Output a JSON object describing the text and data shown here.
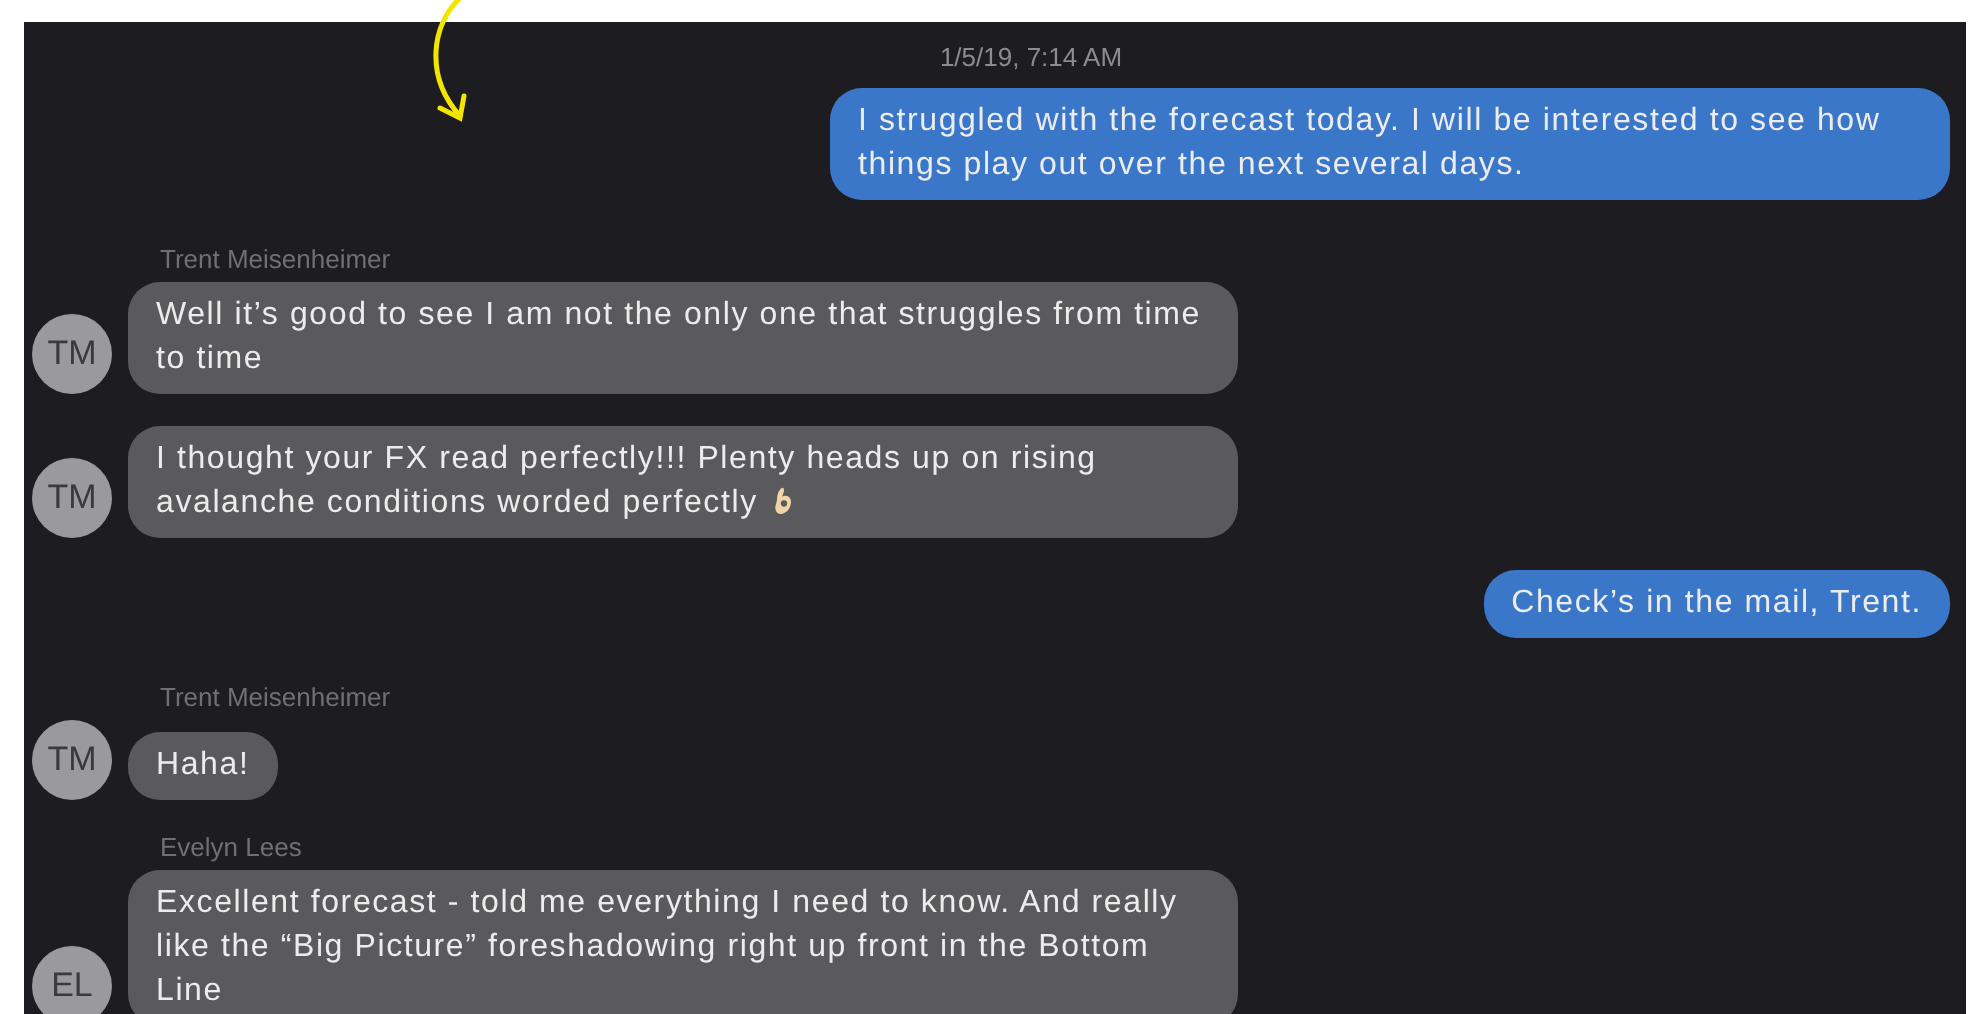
{
  "conversation": [
    {
      "kind": "timestamp",
      "text": "1/5/19, 7:14 AM"
    },
    {
      "kind": "sent",
      "text": "I struggled with the forecast today.  I will be interested to see how things play out over the next several days.",
      "has_icon": false
    },
    {
      "kind": "sender_name",
      "text": "Trent Meisenheimer"
    },
    {
      "kind": "received",
      "text": "Well it’s good to see I am not the only one that struggles from time to time",
      "avatar": "TM",
      "has_icon": false
    },
    {
      "kind": "received",
      "text": "I thought your FX read perfectly!!! Plenty heads up on rising avalanche conditions worded perfectly",
      "avatar": "TM",
      "has_icon": true
    },
    {
      "kind": "sent",
      "text": "Check’s in the mail, Trent.",
      "has_icon": false
    },
    {
      "kind": "sender_name",
      "text": "Trent Meisenheimer"
    },
    {
      "kind": "received",
      "text": "Haha!",
      "avatar": "TM",
      "has_icon": false
    },
    {
      "kind": "sender_name",
      "text": "Evelyn Lees"
    },
    {
      "kind": "received",
      "text": "Excellent forecast - told me everything I need to know. And really like the “Big Picture” foreshadowing right up front in the Bottom Line",
      "avatar": "EL",
      "has_icon": false
    }
  ]
}
